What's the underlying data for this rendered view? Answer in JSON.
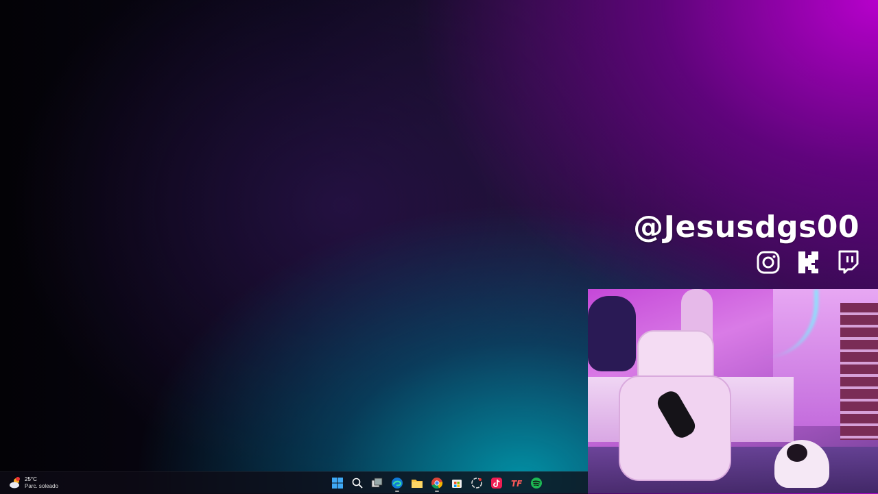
{
  "overlay": {
    "handle": "@Jesusdgs00",
    "socials": [
      "instagram-icon",
      "kick-icon",
      "twitch-icon"
    ]
  },
  "taskbar": {
    "weather": {
      "temp": "25°C",
      "condition": "Parc. soleado",
      "icon": "partly-sunny-icon"
    },
    "pinned": [
      "windows-start-icon",
      "search-icon",
      "task-view-icon",
      "edge-icon",
      "file-explorer-icon",
      "chrome-icon",
      "microsoft-store-icon",
      "openai-icon",
      "tiktok-icon",
      "tf-app-icon",
      "spotify-icon"
    ]
  },
  "colors": {
    "accent_magenta": "#b800d8",
    "accent_teal": "#0096aa",
    "taskbar_bg": "#0e0c16",
    "spotify_green": "#1db954"
  }
}
